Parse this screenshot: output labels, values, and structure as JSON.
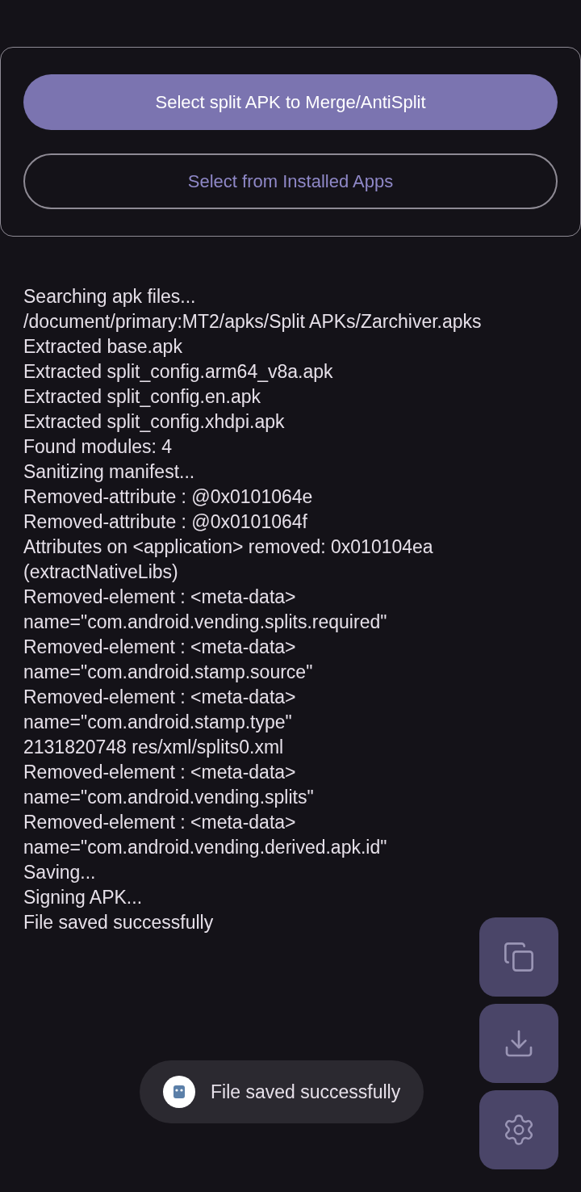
{
  "buttons": [
    {
      "label": "Select split APK to Merge/AntiSplit",
      "kind": "filled"
    },
    {
      "label": "Select from Installed Apps",
      "kind": "outlined"
    }
  ],
  "log": [
    "Searching apk files...",
    "/document/primary:MT2/apks/Split APKs/Zarchiver.apks",
    "Extracted base.apk",
    "Extracted split_config.arm64_v8a.apk",
    "Extracted split_config.en.apk",
    "Extracted split_config.xhdpi.apk",
    "Found modules: 4",
    "Sanitizing manifest...",
    "Removed-attribute : @0x0101064e",
    "Removed-attribute : @0x0101064f",
    "Attributes on <application> removed: 0x010104ea",
    "(extractNativeLibs)",
    "Removed-element : <meta-data>",
    "name=\"com.android.vending.splits.required\"",
    "Removed-element : <meta-data>",
    "name=\"com.android.stamp.source\"",
    "Removed-element : <meta-data>",
    "name=\"com.android.stamp.type\"",
    "2131820748 res/xml/splits0.xml",
    "Removed-element : <meta-data>",
    "name=\"com.android.vending.splits\"",
    "Removed-element : <meta-data>",
    "name=\"com.android.vending.derived.apk.id\"",
    "Saving...",
    "Signing APK...",
    "File saved successfully"
  ],
  "fabs": [
    {
      "kind": "copy"
    },
    {
      "kind": "download"
    },
    {
      "kind": "settings"
    }
  ],
  "toast": {
    "text": "File saved successfully"
  }
}
